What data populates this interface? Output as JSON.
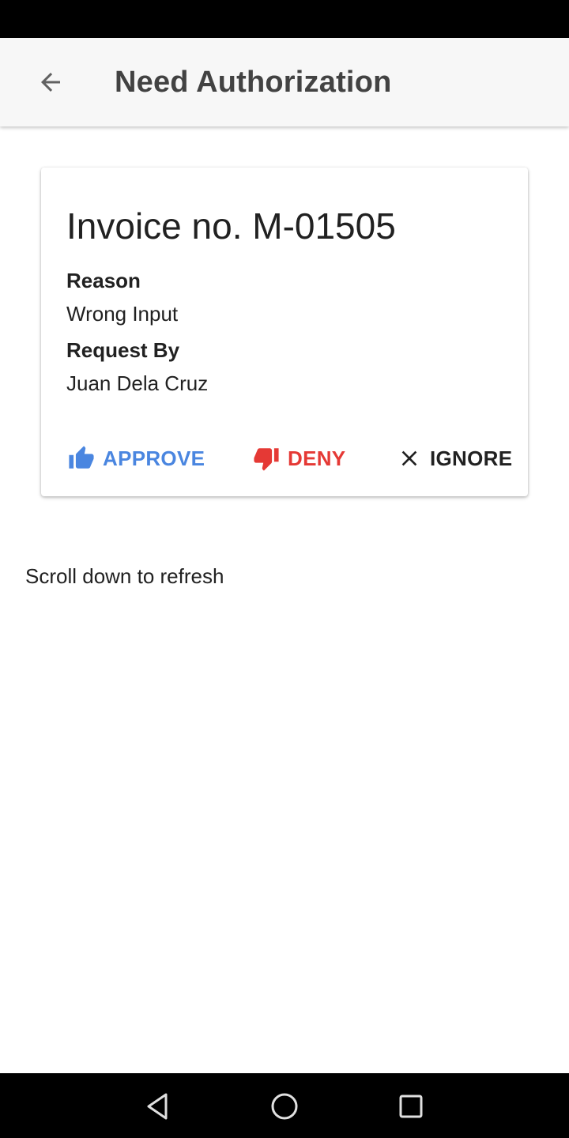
{
  "app_bar": {
    "title": "Need Authorization",
    "back_icon": "arrow-left-icon"
  },
  "card": {
    "invoice_title": "Invoice no. M-01505",
    "reason_label": "Reason",
    "reason_value": "Wrong Input",
    "request_by_label": "Request By",
    "request_by_value": "Juan Dela Cruz",
    "actions": {
      "approve_label": "APPROVE",
      "deny_label": "DENY",
      "ignore_label": "IGNORE"
    }
  },
  "refresh_hint": "Scroll down to refresh",
  "colors": {
    "approve": "#4a86e0",
    "deny": "#e53935",
    "app_bar_bg": "#f7f7f7",
    "system_bar_bg": "#000000"
  },
  "icons": {
    "approve": "thumb-up-icon",
    "deny": "thumb-down-icon",
    "ignore": "close-icon",
    "nav_back": "triangle-back-icon",
    "nav_home": "circle-home-icon",
    "nav_recents": "square-recents-icon"
  }
}
